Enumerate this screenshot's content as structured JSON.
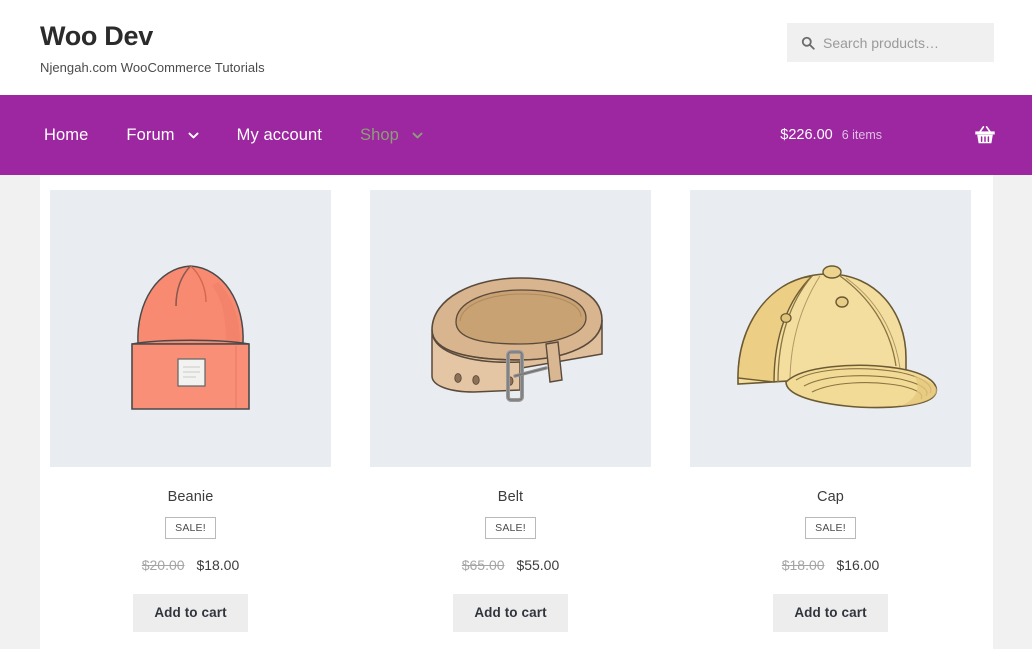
{
  "header": {
    "site_title": "Woo Dev",
    "tagline": "Njengah.com WooCommerce Tutorials",
    "search": {
      "placeholder": "Search products…",
      "value": "",
      "icon": "search-icon"
    }
  },
  "nav": {
    "items": [
      {
        "label": "Home",
        "has_dropdown": false,
        "dimmed": false
      },
      {
        "label": "Forum",
        "has_dropdown": true,
        "dimmed": false
      },
      {
        "label": "My account",
        "has_dropdown": false,
        "dimmed": false
      },
      {
        "label": "Shop",
        "has_dropdown": true,
        "dimmed": true
      }
    ],
    "cart": {
      "amount": "$226.00",
      "items_text": "6 items",
      "icon": "shopping-basket-icon"
    }
  },
  "products": [
    {
      "title": "Beanie",
      "badge": "SALE!",
      "price_old": "$20.00",
      "price_new": "$18.00",
      "add_to_cart_label": "Add to cart",
      "image_name": "beanie-illustration"
    },
    {
      "title": "Belt",
      "badge": "SALE!",
      "price_old": "$65.00",
      "price_new": "$55.00",
      "add_to_cart_label": "Add to cart",
      "image_name": "belt-illustration"
    },
    {
      "title": "Cap",
      "badge": "SALE!",
      "price_old": "$18.00",
      "price_new": "$16.00",
      "add_to_cart_label": "Add to cart",
      "image_name": "cap-illustration"
    }
  ],
  "colors": {
    "nav_purple": "#9c27a0",
    "page_background": "#f1f1f1",
    "content_background": "#ffffff",
    "thumb_background": "#e9edf1",
    "button_background": "#ededed",
    "dimmed_nav_text": "#8c9e78",
    "beanie_color": "#f98a72",
    "belt_color": "#cfab85",
    "cap_color": "#f4de9f"
  }
}
